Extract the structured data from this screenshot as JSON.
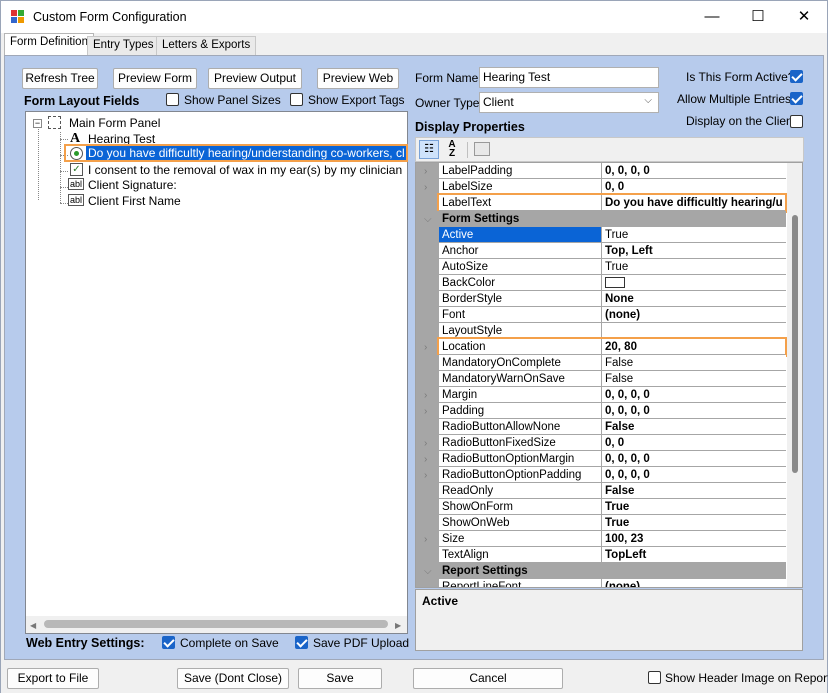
{
  "window": {
    "title": "Custom Form Configuration",
    "minimize": "—",
    "maximize": "☐",
    "close": "✕"
  },
  "tabs": [
    "Form Definition",
    "Entry Types",
    "Letters & Exports"
  ],
  "toolbar": {
    "refresh_tree": "Refresh Tree",
    "preview_form": "Preview Form",
    "preview_output": "Preview Output",
    "preview_web": "Preview Web"
  },
  "layout": {
    "title": "Form Layout Fields",
    "show_panel_sizes": "Show Panel Sizes",
    "show_export_tags": "Show Export Tags"
  },
  "tree": {
    "root": "Main Form Panel",
    "items": [
      {
        "icon": "A",
        "label": "Hearing Test"
      },
      {
        "icon": "radio",
        "label": "Do you have difficultly hearing/understanding co-workers, clients o"
      },
      {
        "icon": "check",
        "label": "I consent to the removal of wax in my ear(s) by my clinician (if applic"
      },
      {
        "icon": "abl",
        "label": "Client Signature:"
      },
      {
        "icon": "abl",
        "label": "Client First Name"
      }
    ]
  },
  "form": {
    "name_label": "Form Name",
    "name_value": "Hearing Test",
    "owner_label": "Owner Type",
    "owner_value": "Client",
    "active_label": "Is This Form Active?",
    "multi_label": "Allow Multiple Entries?",
    "client_label": "Display on the Client"
  },
  "display_properties": "Display Properties",
  "properties": [
    {
      "type": "row",
      "name": "LabelPadding",
      "value": "0, 0, 0, 0",
      "bold": true,
      "exp": true
    },
    {
      "type": "row",
      "name": "LabelSize",
      "value": "0, 0",
      "bold": true,
      "exp": true
    },
    {
      "type": "row",
      "name": "LabelText",
      "value": "Do you have difficultly hearing/u",
      "bold": true,
      "hl": true
    },
    {
      "type": "cat",
      "name": "Form Settings"
    },
    {
      "type": "row",
      "name": "Active",
      "value": "True",
      "sel": true
    },
    {
      "type": "row",
      "name": "Anchor",
      "value": "Top, Left",
      "bold": true
    },
    {
      "type": "row",
      "name": "AutoSize",
      "value": "True"
    },
    {
      "type": "row",
      "name": "BackColor",
      "value": "",
      "swatch": true
    },
    {
      "type": "row",
      "name": "BorderStyle",
      "value": "None",
      "bold": true
    },
    {
      "type": "row",
      "name": "Font",
      "value": "(none)",
      "bold": true
    },
    {
      "type": "row",
      "name": "LayoutStyle",
      "value": ""
    },
    {
      "type": "row",
      "name": "Location",
      "value": "20, 80",
      "bold": true,
      "exp": true,
      "hl": true
    },
    {
      "type": "row",
      "name": "MandatoryOnComplete",
      "value": "False"
    },
    {
      "type": "row",
      "name": "MandatoryWarnOnSave",
      "value": "False"
    },
    {
      "type": "row",
      "name": "Margin",
      "value": "0, 0, 0, 0",
      "bold": true,
      "exp": true
    },
    {
      "type": "row",
      "name": "Padding",
      "value": "0, 0, 0, 0",
      "bold": true,
      "exp": true
    },
    {
      "type": "row",
      "name": "RadioButtonAllowNone",
      "value": "False",
      "bold": true
    },
    {
      "type": "row",
      "name": "RadioButtonFixedSize",
      "value": "0, 0",
      "bold": true,
      "exp": true
    },
    {
      "type": "row",
      "name": "RadioButtonOptionMargin",
      "value": "0, 0, 0, 0",
      "bold": true,
      "exp": true
    },
    {
      "type": "row",
      "name": "RadioButtonOptionPadding",
      "value": "0, 0, 0, 0",
      "bold": true,
      "exp": true
    },
    {
      "type": "row",
      "name": "ReadOnly",
      "value": "False",
      "bold": true
    },
    {
      "type": "row",
      "name": "ShowOnForm",
      "value": "True",
      "bold": true
    },
    {
      "type": "row",
      "name": "ShowOnWeb",
      "value": "True",
      "bold": true
    },
    {
      "type": "row",
      "name": "Size",
      "value": "100, 23",
      "bold": true,
      "exp": true
    },
    {
      "type": "row",
      "name": "TextAlign",
      "value": "TopLeft",
      "bold": true
    },
    {
      "type": "cat",
      "name": "Report Settings"
    },
    {
      "type": "row",
      "name": "ReportLineFont",
      "value": "(none)",
      "bold": true
    }
  ],
  "description": "Active",
  "web_entry": {
    "title": "Web Entry Settings:",
    "complete_on_save": "Complete on Save",
    "save_pdf": "Save PDF Upload"
  },
  "bottom": {
    "export": "Export to File",
    "save_dont_close": "Save (Dont Close)",
    "save": "Save",
    "cancel": "Cancel",
    "header_image": "Show Header Image on Report?"
  }
}
